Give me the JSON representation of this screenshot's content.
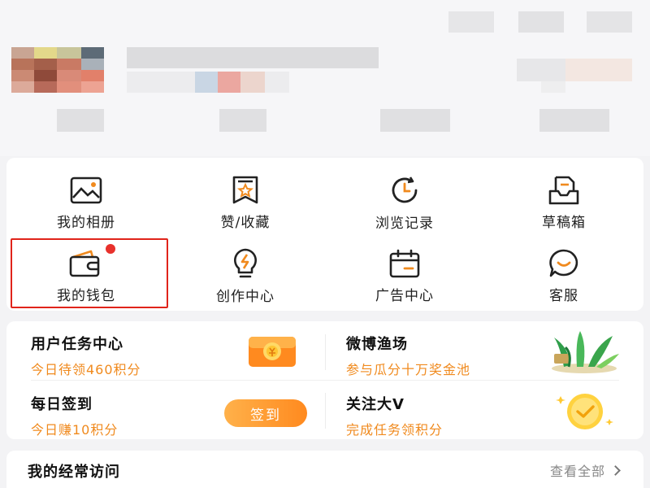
{
  "grid": {
    "items": [
      {
        "label": "我的相册",
        "icon": "photo-album-icon"
      },
      {
        "label": "赞/收藏",
        "icon": "favorite-bookmark-icon"
      },
      {
        "label": "浏览记录",
        "icon": "history-clock-icon"
      },
      {
        "label": "草稿箱",
        "icon": "draft-box-icon"
      },
      {
        "label": "我的钱包",
        "icon": "wallet-icon",
        "badge": "red-dot"
      },
      {
        "label": "创作中心",
        "icon": "lightbulb-icon"
      },
      {
        "label": "广告中心",
        "icon": "calendar-ad-icon"
      },
      {
        "label": "客服",
        "icon": "customer-service-icon"
      }
    ]
  },
  "tasks": {
    "user_task": {
      "title": "用户任务中心",
      "subtitle": "今日待领460积分"
    },
    "fishing": {
      "title": "微博渔场",
      "subtitle": "参与瓜分十万奖金池"
    },
    "daily_sign": {
      "title": "每日签到",
      "subtitle": "今日赚10积分",
      "button": "签到"
    },
    "follow_v": {
      "title": "关注大V",
      "subtitle": "完成任务领积分"
    }
  },
  "frequent": {
    "title": "我的经常访问",
    "view_all": "查看全部"
  },
  "colors": {
    "accent_orange": "#f08a1e",
    "highlight_red": "#e0241b",
    "badge_red": "#e8312c"
  }
}
